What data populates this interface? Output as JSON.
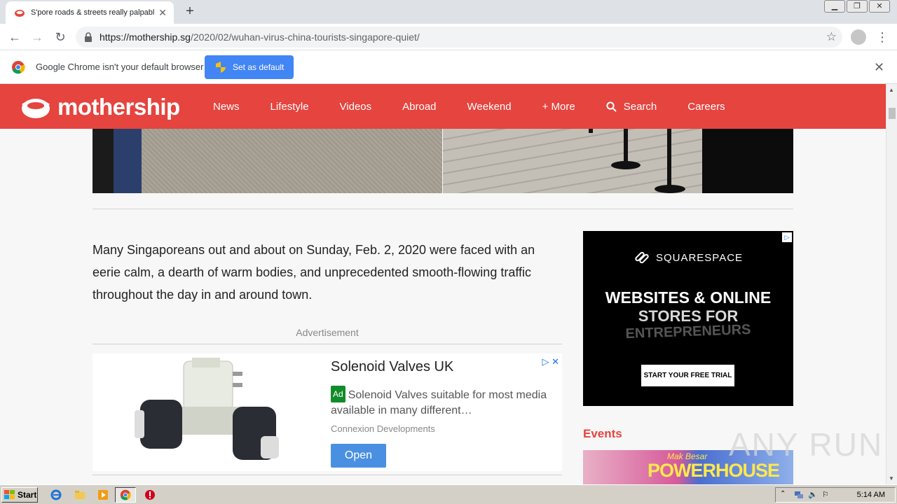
{
  "browser": {
    "tab_title": "S'pore roads & streets really palpabl",
    "url_host": "https://mothership.sg",
    "url_path": "/2020/02/wuhan-virus-china-tourists-singapore-quiet/",
    "infobar_message": "Google Chrome isn't your default browser",
    "set_default_label": "Set as default"
  },
  "site": {
    "brand": "mothership",
    "nav": [
      "News",
      "Lifestyle",
      "Videos",
      "Abroad",
      "Weekend",
      "+ More",
      "Search",
      "Careers"
    ],
    "accent_color": "#e5443f"
  },
  "article": {
    "lede": "Many Singaporeans out and about on Sunday, Feb. 2, 2020 were faced with an eerie calm, a dearth of warm bodies, and unprecedented smooth-flowing traffic throughout the day in and around town.",
    "ad_label": "Advertisement"
  },
  "inline_ad": {
    "headline": "Solenoid Valves UK",
    "tag": "Ad",
    "description": "Solenoid Valves suitable for most media available in many different…",
    "advertiser": "Connexion Developments",
    "cta": "Open"
  },
  "side_ad": {
    "brand": "SQUARESPACE",
    "line1": "WEBSITES & ONLINE",
    "line2": "STORES FOR",
    "line3": "ENTREPRENEURS",
    "cta": "START YOUR FREE TRIAL"
  },
  "events": {
    "heading": "Events",
    "banner_line1": "Mak Besar",
    "banner_line2": "POWERHOUSE"
  },
  "watermark": "ANY RUN",
  "taskbar": {
    "start_label": "Start",
    "clock": "5:14 AM"
  }
}
